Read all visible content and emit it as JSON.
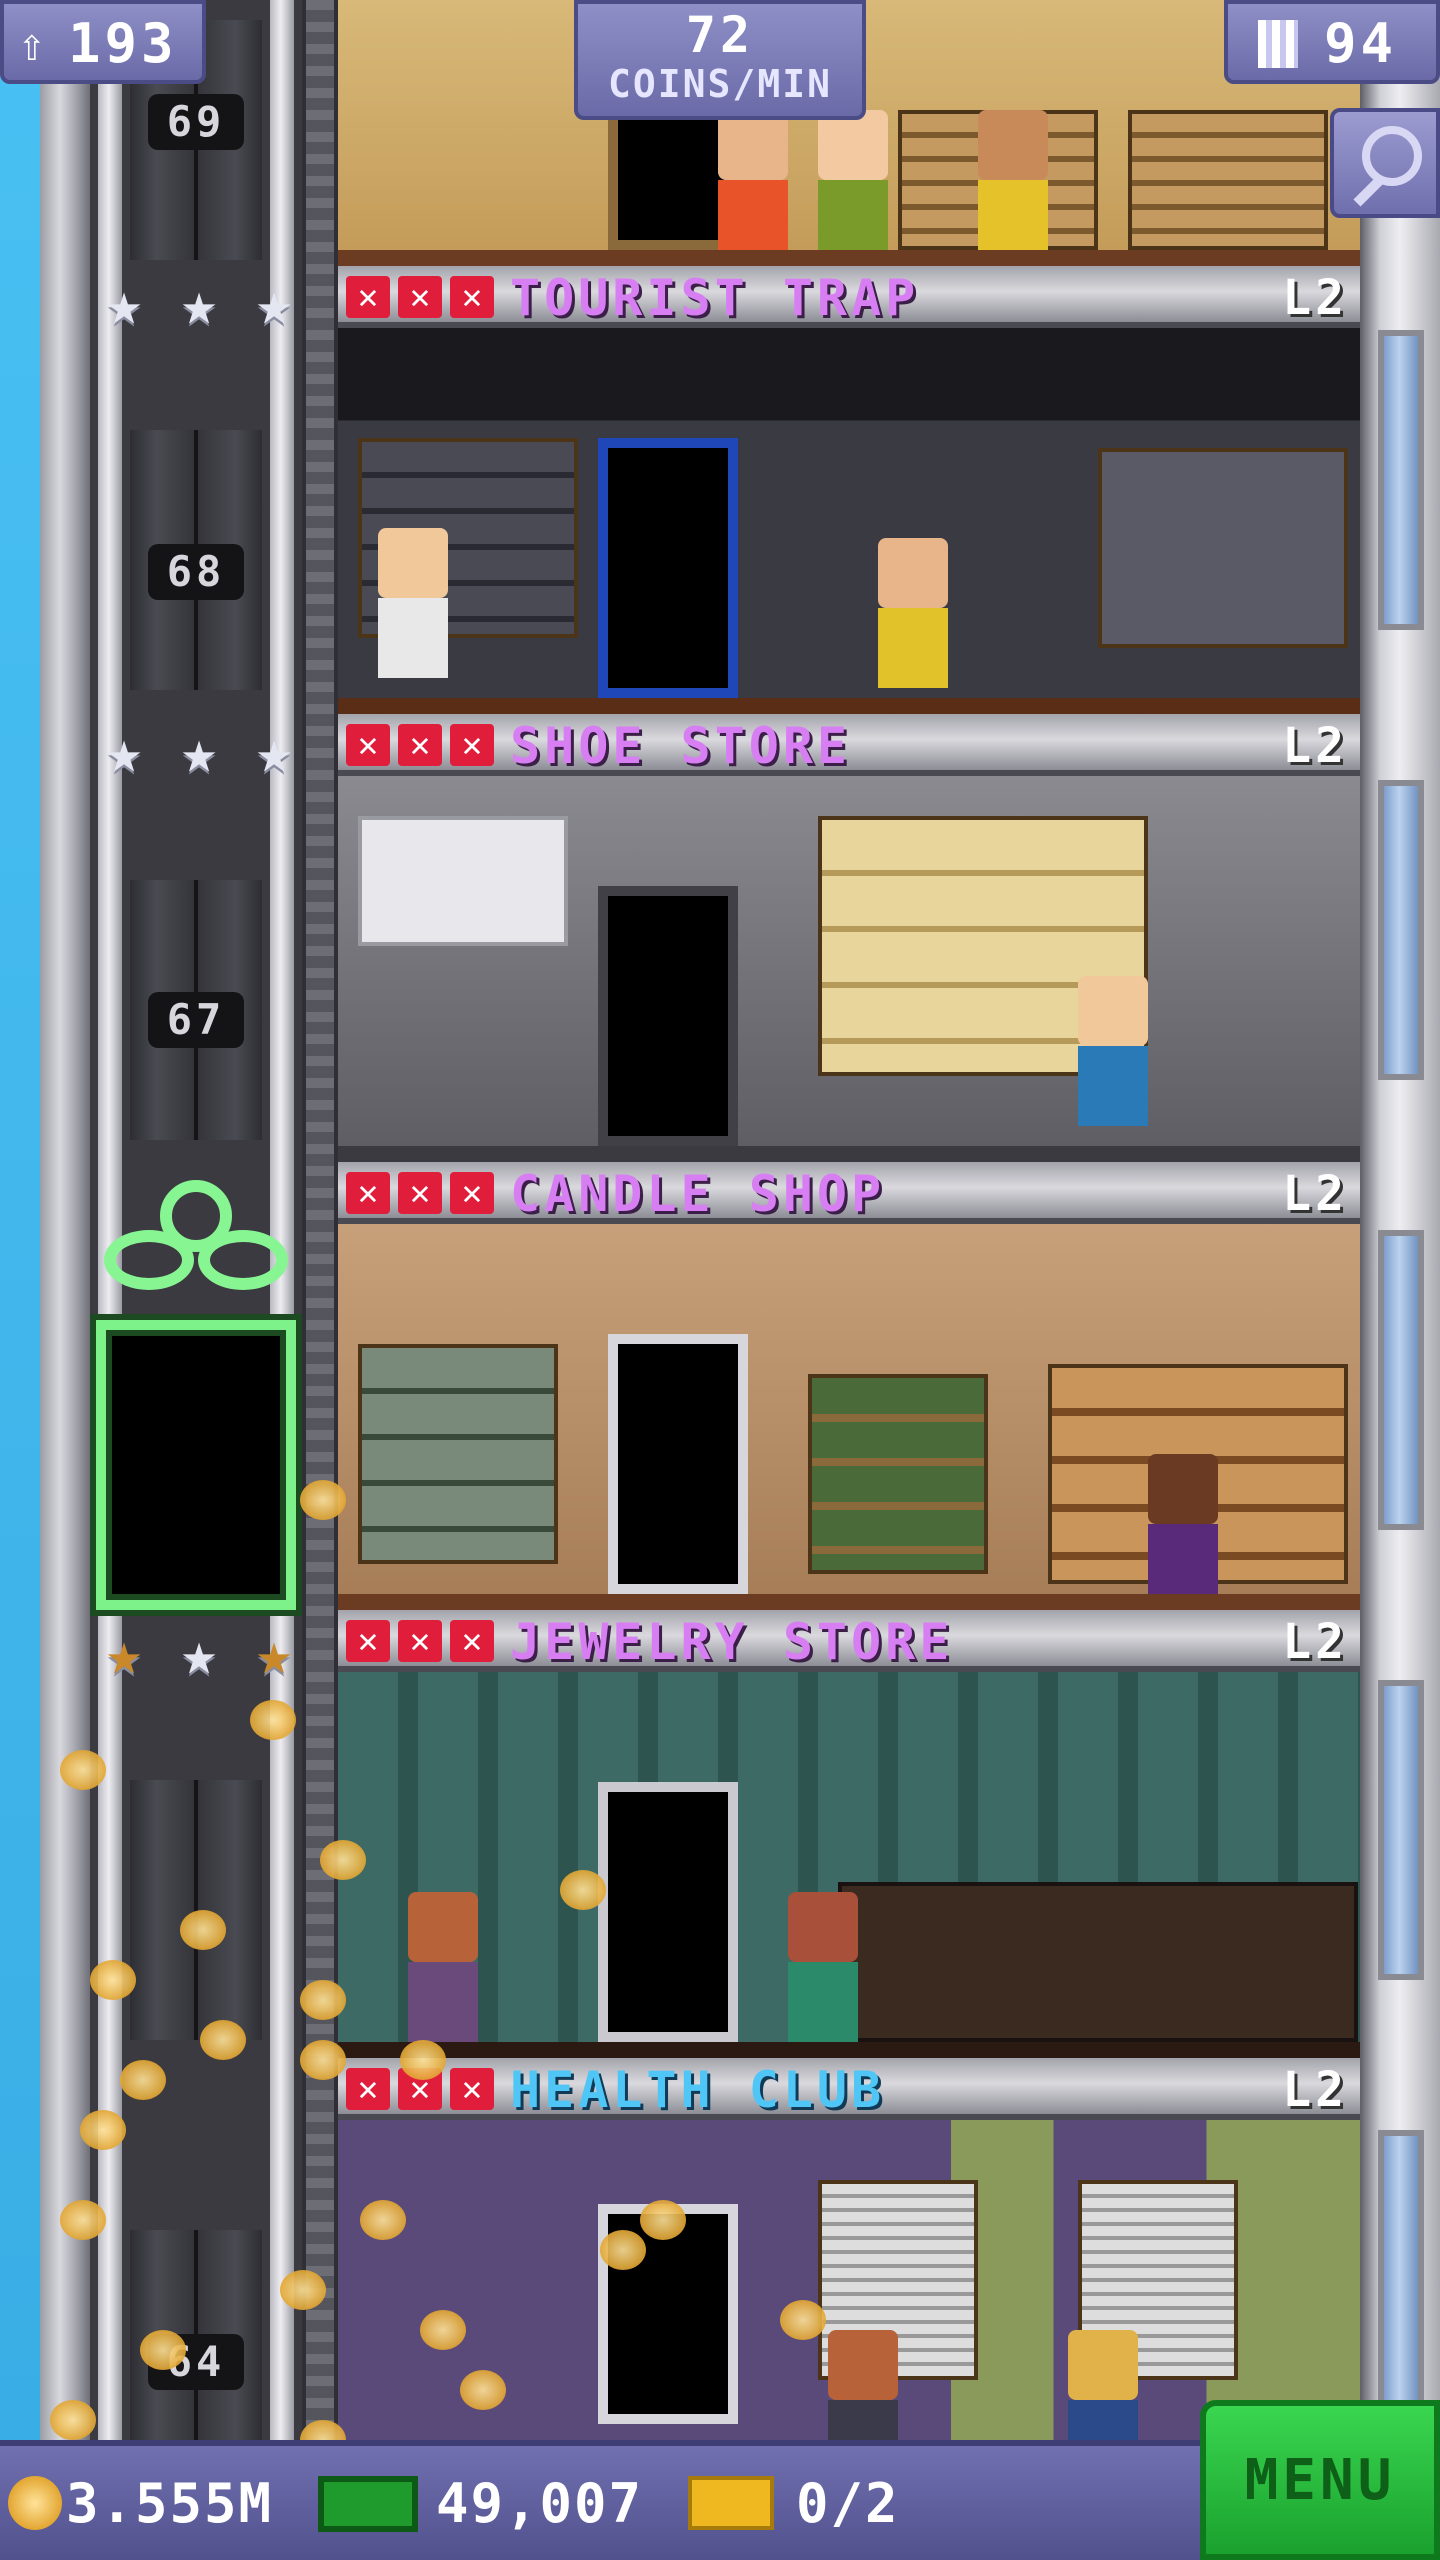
{
  "hud": {
    "population": "193",
    "coins_per_min_value": "72",
    "coins_per_min_label": "COINS/MIN",
    "floors": "94"
  },
  "shaft": {
    "floor_numbers": [
      "69",
      "68",
      "67",
      "64"
    ]
  },
  "floors": [
    {
      "name": "TOURIST TRAP",
      "level": "L2",
      "name_color": "#d77ff2"
    },
    {
      "name": "SHOE STORE",
      "level": "L2",
      "name_color": "#d77ff2"
    },
    {
      "name": "CANDLE SHOP",
      "level": "L2",
      "name_color": "#d77ff2"
    },
    {
      "name": "JEWELRY STORE",
      "level": "L2",
      "name_color": "#d77ff2"
    },
    {
      "name": "HEALTH CLUB",
      "level": "L2",
      "name_color": "#4fc6f5"
    }
  ],
  "bottom_bar": {
    "coins": "3.555M",
    "bux": "49,007",
    "tickets": "0/2",
    "menu_label": "MENU"
  },
  "icons": {
    "population": "person-up-icon",
    "floors": "building-icon",
    "search": "magnifier-icon",
    "coins": "coin-icon",
    "bux": "cash-icon",
    "tickets": "ticket-icon"
  }
}
